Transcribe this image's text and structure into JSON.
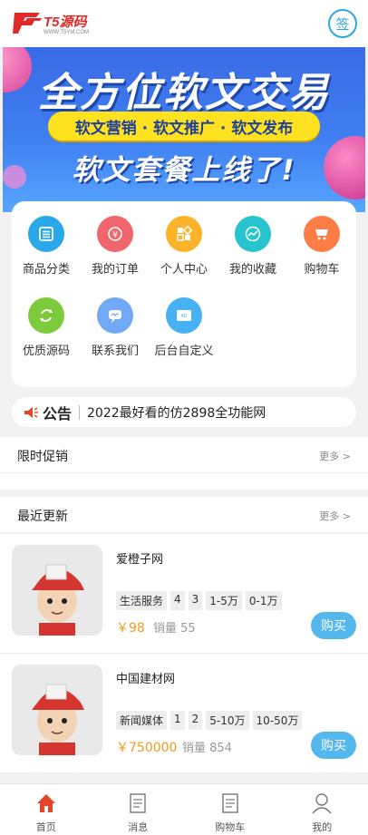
{
  "header": {
    "logo_text": "T5源码",
    "logo_sub": "WWW.T5YM.COM",
    "sign_label": "签"
  },
  "banner": {
    "title": "全方位软文交易",
    "pill": "软文营销 · 软文推广 · 软文发布",
    "subtitle": "软文套餐上线了!"
  },
  "menu": [
    {
      "label": "商品分类",
      "icon": "list-icon",
      "color": "#2ba8ea"
    },
    {
      "label": "我的订单",
      "icon": "yen-icon",
      "color": "#f1666c"
    },
    {
      "label": "个人中心",
      "icon": "grid-icon",
      "color": "#fbb42a"
    },
    {
      "label": "我的收藏",
      "icon": "trend-icon",
      "color": "#27c4cf"
    },
    {
      "label": "购物车",
      "icon": "cart-icon",
      "color": "#fd7d45"
    },
    {
      "label": "优质源码",
      "icon": "refresh-icon",
      "color": "#7dcb3c"
    },
    {
      "label": "联系我们",
      "icon": "chat-icon",
      "color": "#72a9f6"
    },
    {
      "label": "后台自定义",
      "icon": "ad-icon",
      "color": "#47b2f3"
    }
  ],
  "notice": {
    "title": "公告",
    "text": "2022最好看的仿2898全功能网"
  },
  "promo": {
    "title": "限时促销",
    "more": "更多 >"
  },
  "recent": {
    "title": "最近更新",
    "more": "更多 >"
  },
  "products": [
    {
      "name": "爱橙子网",
      "tags": [
        "生活服务",
        "4",
        "3",
        "1-5万",
        "0-1万"
      ],
      "price": "￥98",
      "sales": "销量 55",
      "buy": "购买"
    },
    {
      "name": "中国建材网",
      "tags": [
        "新闻媒体",
        "1",
        "2",
        "5-10万",
        "10-50万"
      ],
      "price": "￥750000",
      "sales": "销量 854",
      "buy": "购买"
    }
  ],
  "tabbar": [
    {
      "label": "首页",
      "icon": "home-icon",
      "active": true
    },
    {
      "label": "消息",
      "icon": "message-icon",
      "active": false
    },
    {
      "label": "购物车",
      "icon": "cart-icon",
      "active": false
    },
    {
      "label": "我的",
      "icon": "user-icon",
      "active": false
    }
  ],
  "colors": {
    "accent": "#54b8ec",
    "price": "#f39a1c",
    "home_active": "#e8432b"
  }
}
